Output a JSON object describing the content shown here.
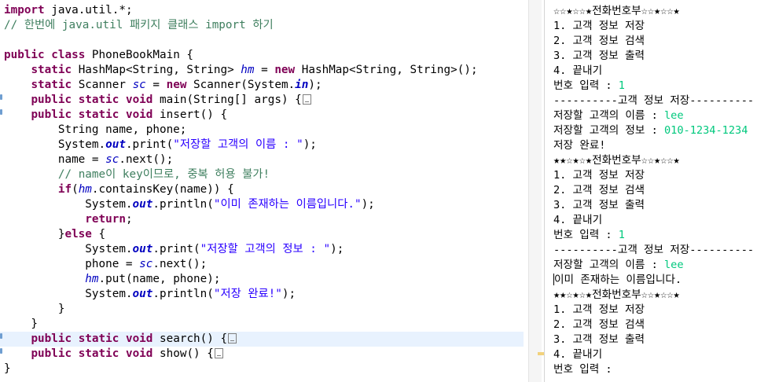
{
  "editor": {
    "lines": [
      {
        "parts": [
          [
            "kw",
            "import"
          ],
          [
            "t",
            " java.util.*;"
          ]
        ]
      },
      {
        "parts": [
          [
            "cm",
            "// 한번에 java.util 패키지 클래스 import 하기"
          ]
        ]
      },
      {
        "parts": []
      },
      {
        "parts": [
          [
            "kw",
            "public"
          ],
          [
            "t",
            " "
          ],
          [
            "kw",
            "class"
          ],
          [
            "t",
            " PhoneBookMain {"
          ]
        ]
      },
      {
        "parts": [
          [
            "t",
            "    "
          ],
          [
            "kw",
            "static"
          ],
          [
            "t",
            " HashMap<String, String> "
          ],
          [
            "fld",
            "hm"
          ],
          [
            "t",
            " = "
          ],
          [
            "kw",
            "new"
          ],
          [
            "t",
            " HashMap<String, String>();"
          ]
        ]
      },
      {
        "parts": [
          [
            "t",
            "    "
          ],
          [
            "kw",
            "static"
          ],
          [
            "t",
            " Scanner "
          ],
          [
            "fld",
            "sc"
          ],
          [
            "t",
            " = "
          ],
          [
            "kw",
            "new"
          ],
          [
            "t",
            " Scanner(System."
          ],
          [
            "sfld",
            "in"
          ],
          [
            "t",
            ");"
          ]
        ]
      },
      {
        "parts": [
          [
            "t",
            "    "
          ],
          [
            "kw",
            "public"
          ],
          [
            "t",
            " "
          ],
          [
            "kw",
            "static"
          ],
          [
            "t",
            " "
          ],
          [
            "kw",
            "void"
          ],
          [
            "t",
            " main(String[] args) {"
          ],
          [
            "fold",
            ""
          ]
        ],
        "marker": true
      },
      {
        "parts": [
          [
            "t",
            "    "
          ],
          [
            "kw",
            "public"
          ],
          [
            "t",
            " "
          ],
          [
            "kw",
            "static"
          ],
          [
            "t",
            " "
          ],
          [
            "kw",
            "void"
          ],
          [
            "t",
            " insert() {"
          ]
        ],
        "marker": true
      },
      {
        "parts": [
          [
            "t",
            "        String name, phone;"
          ]
        ]
      },
      {
        "parts": [
          [
            "t",
            "        System."
          ],
          [
            "sfld",
            "out"
          ],
          [
            "t",
            ".print("
          ],
          [
            "st",
            "\"저장할 고객의 이름 : \""
          ],
          [
            "t",
            ");"
          ]
        ]
      },
      {
        "parts": [
          [
            "t",
            "        name = "
          ],
          [
            "fld",
            "sc"
          ],
          [
            "t",
            ".next();"
          ]
        ]
      },
      {
        "parts": [
          [
            "t",
            "        "
          ],
          [
            "cm",
            "// name이 key이므로, 중복 허용 불가!"
          ]
        ]
      },
      {
        "parts": [
          [
            "t",
            "        "
          ],
          [
            "kw",
            "if"
          ],
          [
            "t",
            "("
          ],
          [
            "fld",
            "hm"
          ],
          [
            "t",
            ".containsKey(name)) {"
          ]
        ]
      },
      {
        "parts": [
          [
            "t",
            "            System."
          ],
          [
            "sfld",
            "out"
          ],
          [
            "t",
            ".println("
          ],
          [
            "st",
            "\"이미 존재하는 이름입니다.\""
          ],
          [
            "t",
            ");"
          ]
        ]
      },
      {
        "parts": [
          [
            "t",
            "            "
          ],
          [
            "kw",
            "return"
          ],
          [
            "t",
            ";"
          ]
        ]
      },
      {
        "parts": [
          [
            "t",
            "        }"
          ],
          [
            "kw",
            "else"
          ],
          [
            "t",
            " {"
          ]
        ]
      },
      {
        "parts": [
          [
            "t",
            "            System."
          ],
          [
            "sfld",
            "out"
          ],
          [
            "t",
            ".print("
          ],
          [
            "st",
            "\"저장할 고객의 정보 : \""
          ],
          [
            "t",
            ");"
          ]
        ]
      },
      {
        "parts": [
          [
            "t",
            "            phone = "
          ],
          [
            "fld",
            "sc"
          ],
          [
            "t",
            ".next();"
          ]
        ]
      },
      {
        "parts": [
          [
            "t",
            "            "
          ],
          [
            "fld",
            "hm"
          ],
          [
            "t",
            ".put(name, phone);"
          ]
        ]
      },
      {
        "parts": [
          [
            "t",
            "            System."
          ],
          [
            "sfld",
            "out"
          ],
          [
            "t",
            ".println("
          ],
          [
            "st",
            "\"저장 완료!\""
          ],
          [
            "t",
            ");"
          ]
        ]
      },
      {
        "parts": [
          [
            "t",
            "        }"
          ]
        ]
      },
      {
        "parts": [
          [
            "t",
            "    }"
          ]
        ]
      },
      {
        "parts": [
          [
            "t",
            "    "
          ],
          [
            "kw",
            "public"
          ],
          [
            "t",
            " "
          ],
          [
            "kw",
            "static"
          ],
          [
            "t",
            " "
          ],
          [
            "kw",
            "void"
          ],
          [
            "t",
            " search() {"
          ],
          [
            "fold",
            ""
          ]
        ],
        "marker": true,
        "highlight": true
      },
      {
        "parts": [
          [
            "t",
            "    "
          ],
          [
            "kw",
            "public"
          ],
          [
            "t",
            " "
          ],
          [
            "kw",
            "static"
          ],
          [
            "t",
            " "
          ],
          [
            "kw",
            "void"
          ],
          [
            "t",
            " show() {"
          ],
          [
            "fold",
            ""
          ]
        ],
        "marker": true
      },
      {
        "parts": [
          [
            "t",
            "}"
          ]
        ]
      }
    ]
  },
  "console": {
    "lines": [
      {
        "parts": [
          [
            "t",
            "☆☆★☆☆★전화번호부☆☆★☆☆★"
          ]
        ]
      },
      {
        "parts": [
          [
            "t",
            "1. 고객 정보 저장"
          ]
        ]
      },
      {
        "parts": [
          [
            "t",
            "2. 고객 정보 검색"
          ]
        ]
      },
      {
        "parts": [
          [
            "t",
            "3. 고객 정보 출력"
          ]
        ]
      },
      {
        "parts": [
          [
            "t",
            "4. 끝내기"
          ]
        ]
      },
      {
        "parts": [
          [
            "t",
            "번호 입력 : "
          ],
          [
            "inp",
            "1"
          ]
        ]
      },
      {
        "parts": [
          [
            "t",
            "----------고객 정보 저장----------"
          ]
        ]
      },
      {
        "parts": [
          [
            "t",
            "저장할 고객의 이름 : "
          ],
          [
            "inp",
            "lee"
          ]
        ]
      },
      {
        "parts": [
          [
            "t",
            "저장할 고객의 정보 : "
          ],
          [
            "inp",
            "010-1234-1234"
          ]
        ]
      },
      {
        "parts": [
          [
            "t",
            "저장 완료!"
          ]
        ]
      },
      {
        "parts": [
          [
            "t",
            "★★☆★☆★전화번호부☆☆★☆☆★"
          ]
        ]
      },
      {
        "parts": [
          [
            "t",
            "1. 고객 정보 저장"
          ]
        ]
      },
      {
        "parts": [
          [
            "t",
            "2. 고객 정보 검색"
          ]
        ]
      },
      {
        "parts": [
          [
            "t",
            "3. 고객 정보 출력"
          ]
        ]
      },
      {
        "parts": [
          [
            "t",
            "4. 끝내기"
          ]
        ]
      },
      {
        "parts": [
          [
            "t",
            "번호 입력 : "
          ],
          [
            "inp",
            "1"
          ]
        ]
      },
      {
        "parts": [
          [
            "t",
            "----------고객 정보 저장----------"
          ]
        ]
      },
      {
        "parts": [
          [
            "t",
            "저장할 고객의 이름 : "
          ],
          [
            "inp",
            "lee"
          ]
        ]
      },
      {
        "parts": [
          [
            "cur",
            ""
          ],
          [
            "t",
            "이미 존재하는 이름입니다."
          ]
        ]
      },
      {
        "parts": [
          [
            "t",
            "★★☆★☆★전화번호부☆☆★☆☆★"
          ]
        ]
      },
      {
        "parts": [
          [
            "t",
            "1. 고객 정보 저장"
          ]
        ]
      },
      {
        "parts": [
          [
            "t",
            "2. 고객 정보 검색"
          ]
        ]
      },
      {
        "parts": [
          [
            "t",
            "3. 고객 정보 출력"
          ]
        ]
      },
      {
        "parts": [
          [
            "t",
            "4. 끝내기"
          ]
        ]
      },
      {
        "parts": [
          [
            "t",
            "번호 입력 : "
          ]
        ]
      }
    ]
  },
  "colors": {
    "keyword": "#7f0055",
    "comment": "#3f7f5f",
    "string": "#2a00ff",
    "field": "#0000c0",
    "console_input": "#00c87d",
    "current_line": "#e8f2fe"
  }
}
